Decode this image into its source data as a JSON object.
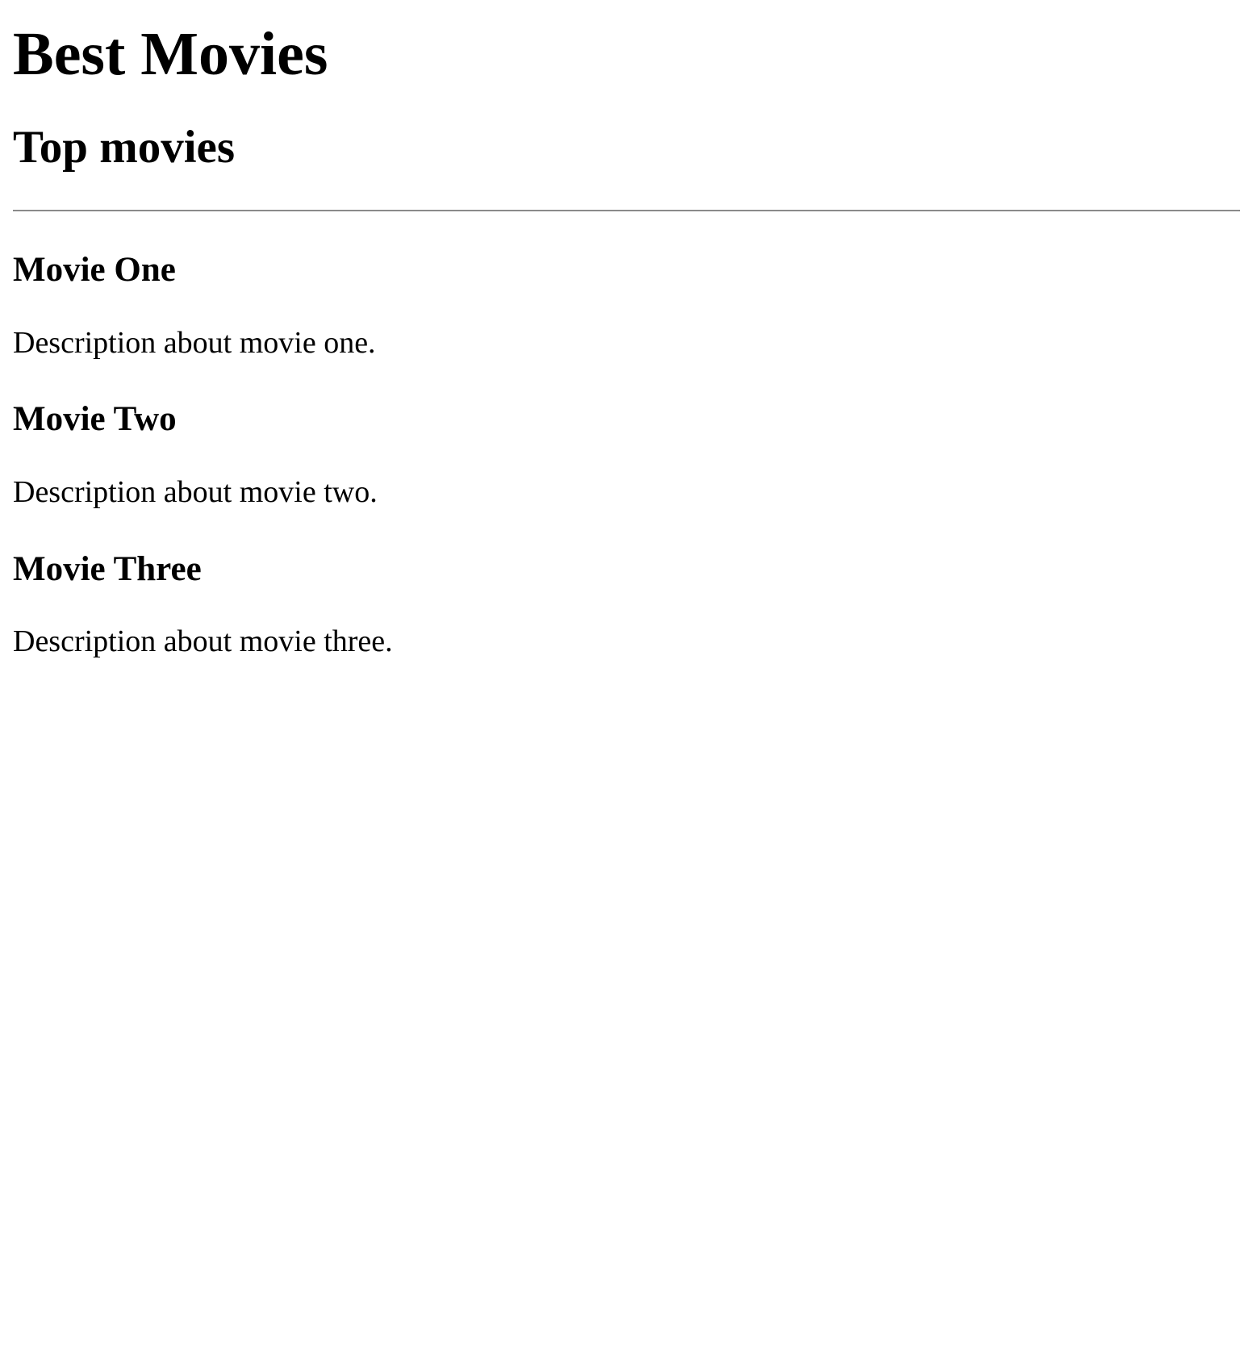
{
  "header": {
    "site_title": "Best Movies",
    "section_title": "Top movies"
  },
  "movies": [
    {
      "title": "Movie One",
      "description": "Description about movie one."
    },
    {
      "title": "Movie Two",
      "description": "Description about movie two."
    },
    {
      "title": "Movie Three",
      "description": "Description about movie three."
    }
  ],
  "colors": {
    "background": "#ffffff",
    "text": "#000000",
    "divider": "#8a8a8a"
  }
}
